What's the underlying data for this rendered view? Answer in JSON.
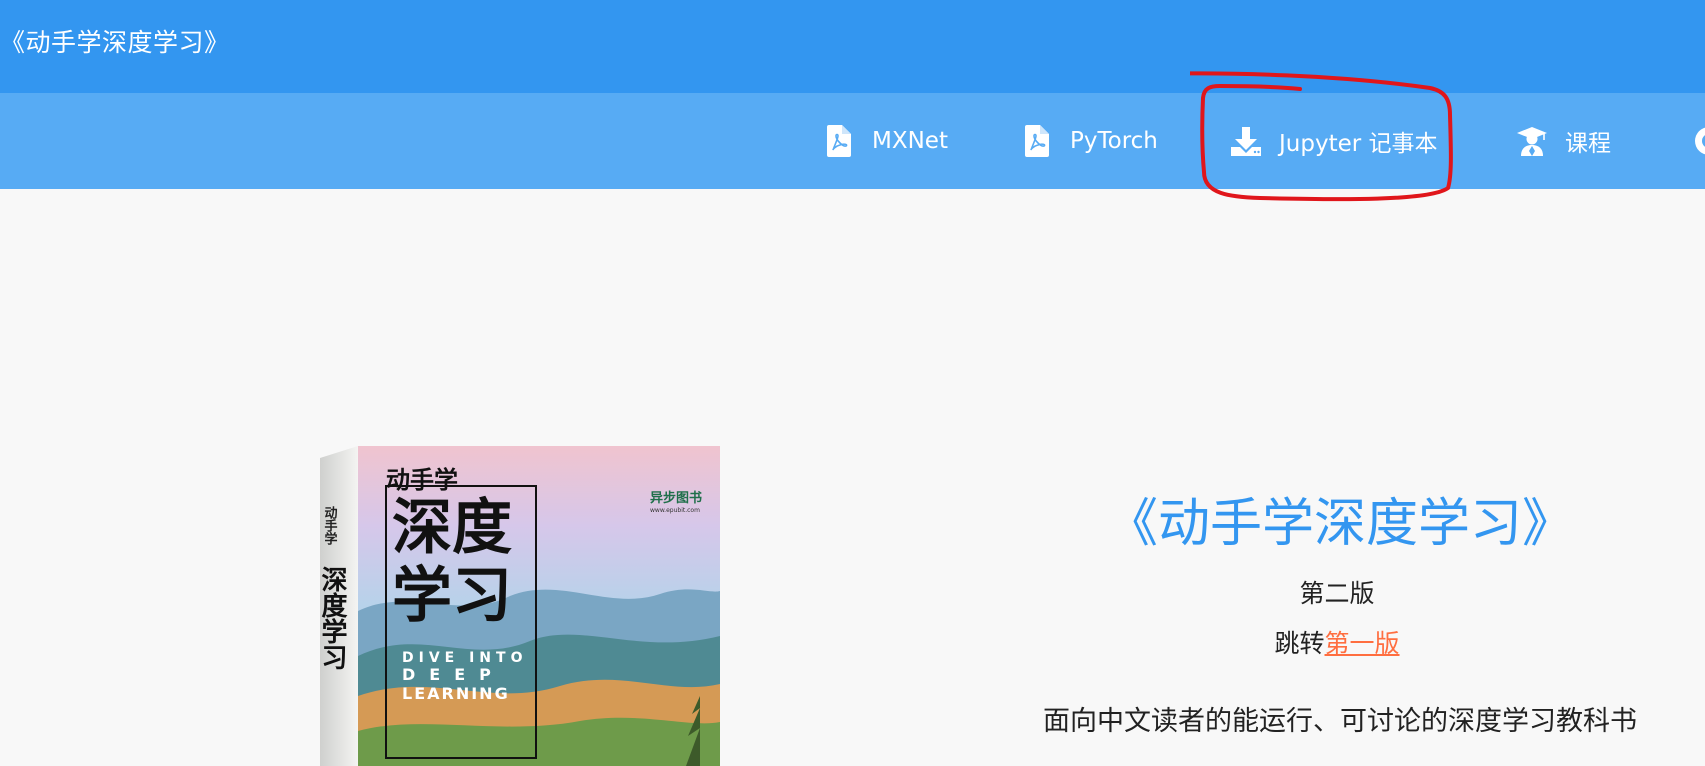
{
  "header": {
    "title": "《动手学深度学习》"
  },
  "nav": {
    "items": [
      {
        "label": "MXNet",
        "icon": "pdf-icon"
      },
      {
        "label": "PyTorch",
        "icon": "pdf-icon"
      },
      {
        "label": "Jupyter 记事本",
        "icon": "download-icon"
      },
      {
        "label": "课程",
        "icon": "graduation-cap-icon"
      }
    ]
  },
  "hero": {
    "title": "《动手学深度学习》",
    "edition": "第二版",
    "jump_prefix": "跳转",
    "jump_link": "第一版",
    "tagline": "面向中文读者的能运行、可讨论的深度学习教科书"
  },
  "book_cover": {
    "spine_brand": "动手学",
    "spine_title": "深度学习",
    "brand": "动手学",
    "title_line1": "深度",
    "title_line2": "学习",
    "english_line1": "DIVE INTO",
    "english_line2": "DEEP",
    "english_line3": "LEARNING",
    "publisher": "异步图书",
    "publisher_url": "www.epubit.com"
  },
  "colors": {
    "header_bg": "#3396f0",
    "navbar_bg": "#57abf4",
    "accent": "#3396f0",
    "link": "#ff6e40",
    "annotation": "#e0161b"
  }
}
